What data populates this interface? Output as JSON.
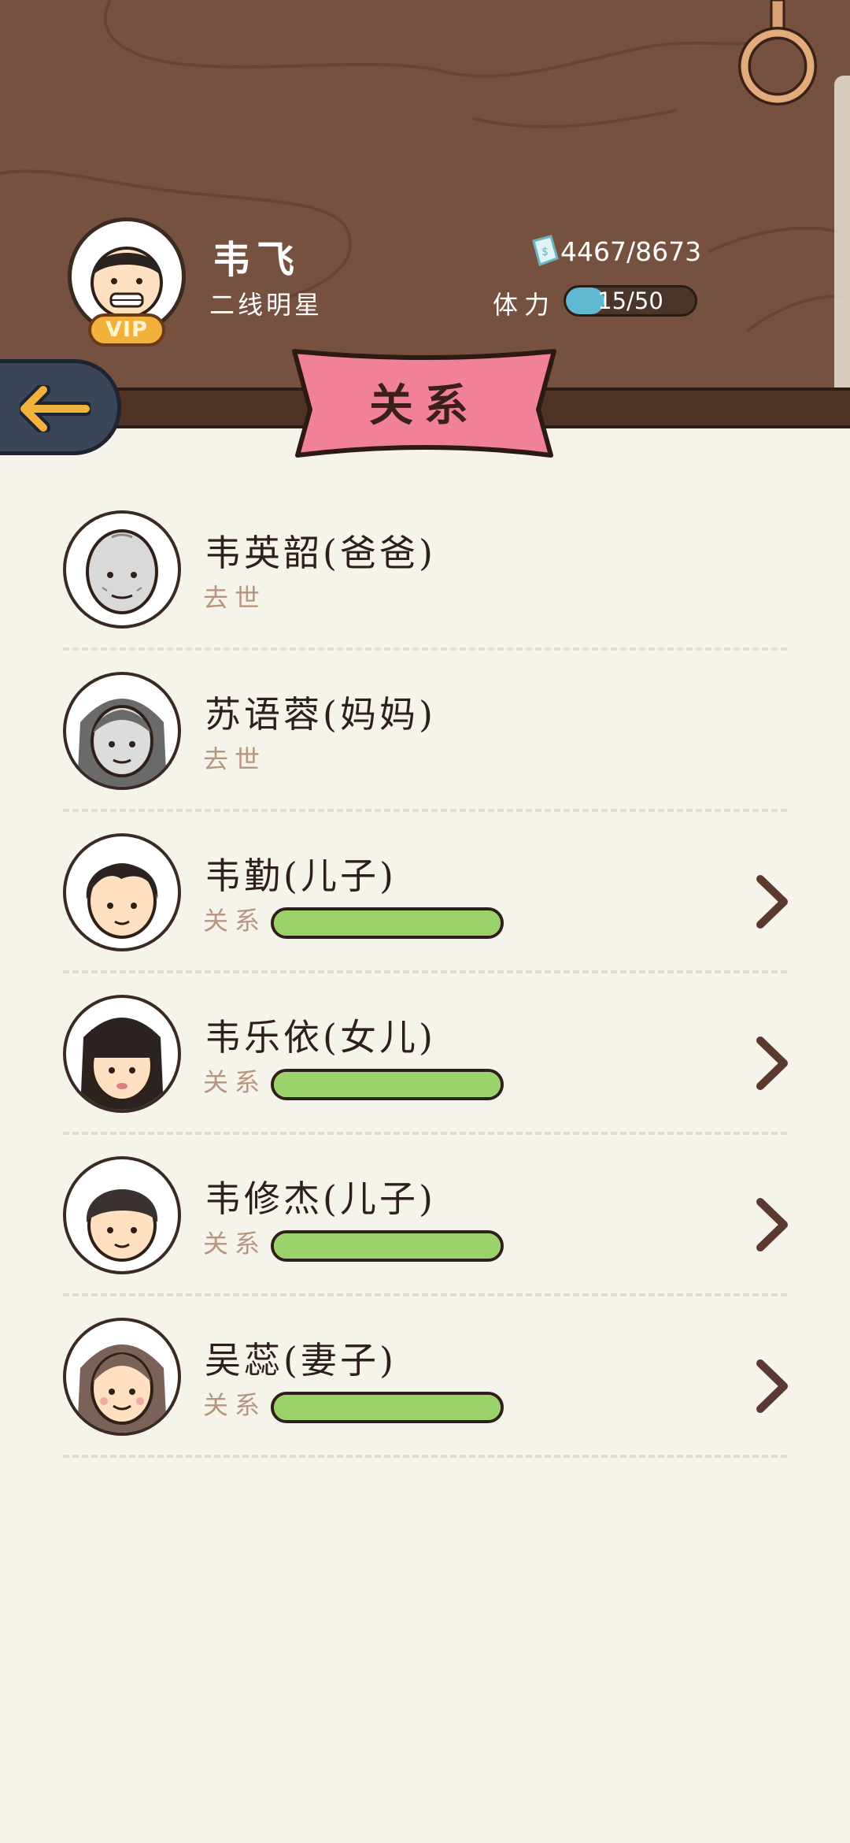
{
  "header": {
    "player_name": "韦飞",
    "player_title": "二线明星",
    "vip_label": "VIP",
    "money": "4467/8673",
    "stamina_label": "体力",
    "stamina_text": "15/50",
    "stamina_fraction": 0.3
  },
  "page": {
    "title": "关系"
  },
  "colors": {
    "wood": "#765140",
    "ribbon": "#f08196",
    "relation_bar": "#9bd36a",
    "stamina_bar": "#5fb9d0",
    "back_button": "#3a4657",
    "back_arrow": "#f3b23c"
  },
  "relations": [
    {
      "name": "韦英韶(爸爸)",
      "status": "去世",
      "deceased": true,
      "avatar": "old-bald-man-avatar-icon"
    },
    {
      "name": "苏语蓉(妈妈)",
      "status": "去世",
      "deceased": true,
      "avatar": "old-woman-avatar-icon"
    },
    {
      "name": "韦勤(儿子)",
      "status": "关系",
      "deceased": false,
      "relation_level": 1.0,
      "avatar": "young-man-avatar-icon"
    },
    {
      "name": "韦乐依(女儿)",
      "status": "关系",
      "deceased": false,
      "relation_level": 1.0,
      "avatar": "young-woman-avatar-icon"
    },
    {
      "name": "韦修杰(儿子)",
      "status": "关系",
      "deceased": false,
      "relation_level": 1.0,
      "avatar": "young-man-avatar-icon"
    },
    {
      "name": "吴蕊(妻子)",
      "status": "关系",
      "deceased": false,
      "relation_level": 1.0,
      "avatar": "woman-avatar-icon"
    }
  ]
}
